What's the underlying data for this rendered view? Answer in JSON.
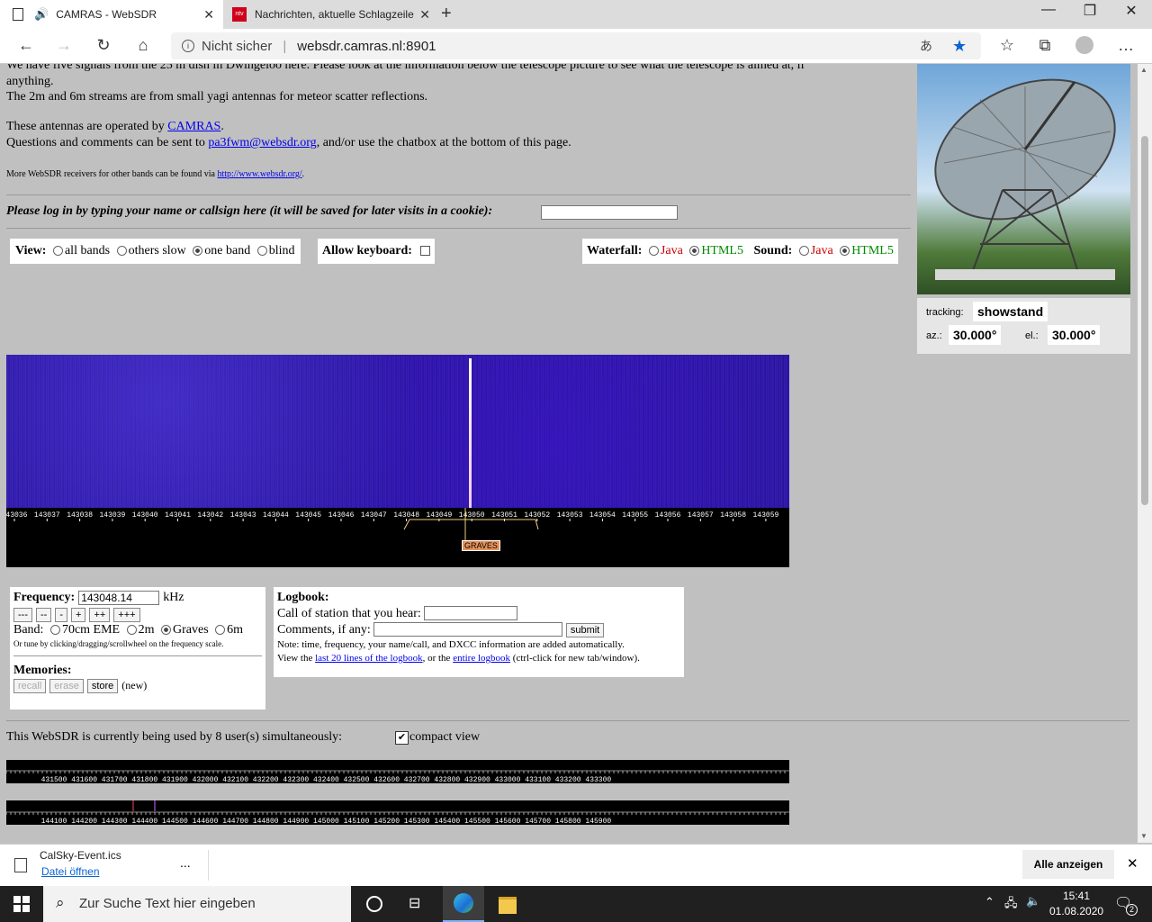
{
  "browser": {
    "tabs": [
      {
        "label": "CAMRAS - WebSDR"
      },
      {
        "label": "Nachrichten, aktuelle Schlagzeile"
      }
    ],
    "security": "Nicht sicher",
    "url": "websdr.camras.nl:8901"
  },
  "intro": {
    "line1": "We have five signals from the 25 m dish in Dwingeloo here. Please look at the information below the telescope picture to see what the telescope is aimed at, if",
    "line2": "anything.",
    "line3": "The 2m and 6m streams are from small yagi antennas for meteor scatter reflections.",
    "operated_prefix": "These antennas are operated by ",
    "operated_link": "CAMRAS",
    "operated_suffix": ".",
    "questions_prefix": "Questions and comments can be sent to ",
    "email": "pa3fwm@websdr.org",
    "questions_suffix": ", and/or use the chatbox at the bottom of this page.",
    "more_prefix": "More WebSDR receivers for other bands can be found via ",
    "more_link": "http://www.websdr.org/",
    "more_suffix": "."
  },
  "login": {
    "label": "Please log in by typing your name or callsign here (it will be saved for later visits in a cookie):"
  },
  "view": {
    "label": "View:",
    "options": [
      "all bands",
      "others slow",
      "one band",
      "blind"
    ],
    "selected": "one band",
    "keyboard_label": "Allow keyboard:"
  },
  "waterfall": {
    "label": "Waterfall:",
    "options": [
      "Java",
      "HTML5"
    ],
    "sound_label": "Sound:",
    "sound_options": [
      "Java",
      "HTML5"
    ]
  },
  "scale": {
    "ticks": [
      "143036",
      "143037",
      "143038",
      "143039",
      "143040",
      "143041",
      "143042",
      "143043",
      "143044",
      "143045",
      "143046",
      "143047",
      "143048",
      "143049",
      "143050",
      "143051",
      "143052",
      "143053",
      "143054",
      "143055",
      "143056",
      "143057",
      "143058",
      "143059"
    ],
    "marker": "GRAVES"
  },
  "telescope": {
    "tracking_label": "tracking:",
    "tracking_value": "showstand",
    "az_label": "az.:",
    "az_value": "30.000°",
    "el_label": "el.:",
    "el_value": "30.000°"
  },
  "freq": {
    "label": "Frequency:",
    "value": "143048.14",
    "unit": "kHz",
    "buttons": [
      "---",
      "--",
      "-",
      "+",
      "++",
      "+++"
    ],
    "band_label": "Band:",
    "bands": [
      "70cm EME",
      "2m",
      "Graves",
      "6m"
    ],
    "selected_band": "Graves",
    "hint": "Or tune by clicking/dragging/scrollwheel on the frequency scale.",
    "memories_label": "Memories:",
    "mem_buttons": [
      "recall",
      "erase",
      "store"
    ],
    "mem_new": "(new)"
  },
  "logbook": {
    "title": "Logbook:",
    "call_label": "Call of station that you hear:",
    "comments_label": "Comments, if any:",
    "submit": "submit",
    "note": "Note: time, frequency, your name/call, and DXCC information are added automatically.",
    "view_prefix": "View the ",
    "last_link": "last 20 lines of the logbook",
    "view_mid": ", or the ",
    "entire_link": "entire logbook",
    "view_suffix": " (ctrl-click for new tab/window)."
  },
  "users": {
    "text": "This WebSDR is currently being used by 8 user(s) simultaneously:",
    "compact": "compact view",
    "band1_ticks": [
      "431500",
      "431600",
      "431700",
      "431800",
      "431900",
      "432000",
      "432100",
      "432200",
      "432300",
      "432400",
      "432500",
      "432600",
      "432700",
      "432800",
      "432900",
      "433000",
      "433100",
      "433200",
      "433300"
    ],
    "band2_ticks": [
      "144100",
      "144200",
      "144300",
      "144400",
      "144500",
      "144600",
      "144700",
      "144800",
      "144900",
      "145000",
      "145100",
      "145200",
      "145300",
      "145400",
      "145500",
      "145600",
      "145700",
      "145800",
      "145900"
    ]
  },
  "download": {
    "filename": "CalSky-Event.ics",
    "open": "Datei öffnen",
    "more": "...",
    "show_all": "Alle anzeigen"
  },
  "taskbar": {
    "search": "Zur Suche Text hier eingeben",
    "time": "15:41",
    "date": "01.08.2020",
    "notifications": "2"
  }
}
